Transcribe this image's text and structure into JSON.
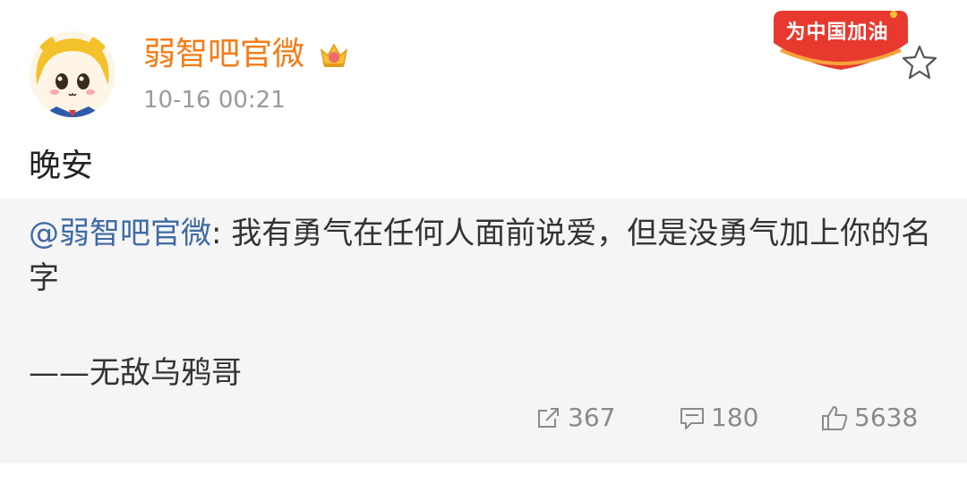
{
  "post": {
    "username": "弱智吧官微",
    "timestamp": "10-16 00:21",
    "badge_text": "为中国加油",
    "text": "晚安"
  },
  "repost": {
    "mention": "@弱智吧官微",
    "separator": ": ",
    "text": "我有勇气在任何人面前说爱，但是没勇气加上你的名字",
    "signature": "——无敌乌鸦哥"
  },
  "actions": {
    "share_count": "367",
    "comment_count": "180",
    "like_count": "5638"
  },
  "colors": {
    "username": "#f57c17",
    "mention": "#3f6aa5",
    "repost_bg": "#f5f5f5",
    "badge": "#e8392f"
  },
  "icons": [
    "avatar",
    "crown-vip-icon",
    "star-icon",
    "share-icon",
    "comment-icon",
    "like-icon"
  ]
}
